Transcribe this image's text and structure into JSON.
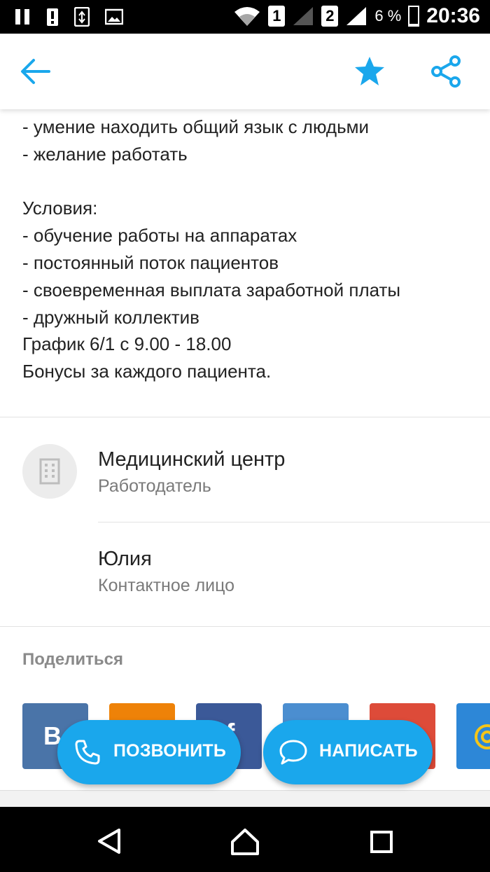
{
  "status_bar": {
    "sim1": "1",
    "sim2": "2",
    "battery_percent": "6 %",
    "battery_level": 0.06,
    "time": "20:36",
    "left_icons": [
      "pause-icon",
      "alert-icon",
      "transfer-icon",
      "image-icon"
    ],
    "right_icons": [
      "wifi-icon",
      "signal-icon",
      "signal-icon",
      "battery-icon"
    ]
  },
  "app_bar": {
    "back_icon": "arrow-left-icon",
    "favorite_icon": "star-icon",
    "share_icon": "share-icon",
    "accent_color": "#1aa7ec"
  },
  "description": {
    "lines": [
      "- умение находить общий язык с людьми",
      "- желание работать",
      "",
      "Условия:",
      "- обучение работы на аппаратах",
      "- постоянный поток пациентов",
      "- своевременная выплата заработной платы",
      "- дружный коллектив",
      "График 6/1 с 9.00 - 18.00",
      "Бонусы за каждого пациента."
    ]
  },
  "employer": {
    "name": "Медицинский центр",
    "role": "Работодатель",
    "icon": "building-icon"
  },
  "contact": {
    "name": "Юлия",
    "role": "Контактное лицо"
  },
  "share_section": {
    "heading": "Поделиться",
    "buttons": [
      {
        "name": "vk",
        "label": "В",
        "color": "#4a74a8"
      },
      {
        "name": "odnoklassniki",
        "label": "",
        "color": "#ee8208"
      },
      {
        "name": "facebook",
        "label": "f",
        "color": "#3b5998"
      },
      {
        "name": "mail-ru",
        "label": "",
        "color": "#4b8ed0"
      },
      {
        "name": "google-plus",
        "label": "",
        "color": "#dd4b39"
      },
      {
        "name": "email",
        "label": "",
        "color": "#2d87d7"
      }
    ]
  },
  "actions": {
    "call_label": "ПОЗВОНИТЬ",
    "call_icon": "phone-icon",
    "message_label": "НАПИСАТЬ",
    "message_icon": "chat-bubble-icon"
  },
  "nav_bar": {
    "back_icon": "nav-back-icon",
    "home_icon": "nav-home-icon",
    "recents_icon": "nav-recents-icon"
  }
}
